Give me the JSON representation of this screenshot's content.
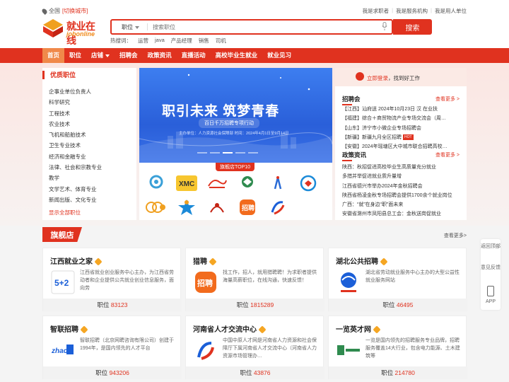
{
  "topbar": {
    "location": "全国",
    "switch_city": "[切换城市]",
    "links": [
      "我是求职者",
      "我是服务机构",
      "我是用人单位"
    ]
  },
  "logo": {
    "cn": "就业在线",
    "en": "jobonline"
  },
  "search": {
    "category": "职位",
    "placeholder": "搜索职位",
    "button": "搜索",
    "hot_label": "热搜词：",
    "hot_words": [
      "运营",
      "java",
      "产品经理",
      "销售",
      "司机"
    ]
  },
  "nav": {
    "items": [
      "首页",
      "职位",
      "店铺",
      "招聘会",
      "政策资讯",
      "直播活动",
      "高校毕业生就业",
      "就业见习"
    ],
    "active": "首页"
  },
  "categories": {
    "title": "优质职位",
    "items": [
      "企事业单位负责人",
      "科学研究",
      "工程技术",
      "农业技术",
      "飞机和船舶技术",
      "卫生专业技术",
      "经济和金融专业",
      "法律、社会和宗教专业",
      "教学",
      "文学艺术、体育专业",
      "新闻出版、文化专业"
    ],
    "all_link": "显示全部职位"
  },
  "banner": {
    "title": "职引未来  筑梦青春",
    "subtitle": "百日千万招聘专项行动",
    "info": "主办单位：人力资源社会保障部    时间：2024年4月1日至9月14日"
  },
  "top10": {
    "label": "旗舰店TOP10",
    "logos": [
      "icon-1",
      "icon-2",
      "icon-3",
      "icon-4",
      "icon-5",
      "icon-6",
      "icon-7",
      "icon-8",
      "icon-9",
      "icon-10"
    ]
  },
  "login": {
    "link": "立即登录",
    "text": "，找到好工作"
  },
  "fairs": {
    "title": "招聘会",
    "more": "查看更多 >",
    "items": [
      "【江西】汕府送 2024年10月23日 汉 在业扶",
      "【福建】综合＋商贸物流产业专场交流会（周…",
      "【山东】济宁市小微企业专场招聘会",
      "【新疆】新疆九月全区招聘",
      "【安徽】2024年瑶塘区大中城市联合招聘高校…"
    ]
  },
  "policy": {
    "title": "政策资讯",
    "more": "查看更多 >",
    "items": [
      "陕西：秋招促进高校毕业生高质量充分就业",
      "多措并举促进就业质升量增",
      "江西省德兴市举办2024年金秋招聘会",
      "陕西省杨凌金秋专场招聘会提供1700余个就业岗位",
      "广西：“就”在身边“职”面未来",
      "安徽省滁州市凤阳县总工会：金秋送岗促就业"
    ]
  },
  "shops": {
    "title": "旗舰店",
    "more": "查看更多>",
    "position_label": "职位",
    "cards": [
      {
        "name": "江西就业之家",
        "desc": "江西省就业创业服务中心主办，为江西省劳动者和企业提供公共就业创业信息服务，面向劳",
        "count": "83123",
        "logo": "jiangxi-logo-icon"
      },
      {
        "name": "猎聘",
        "desc": "找工作，招人，就用猎聘聘！为求职者提供海量高薪职位，在线沟通，快速反馈！",
        "count": "1815289",
        "logo": "liepin-logo-icon"
      },
      {
        "name": "湖北公共招聘",
        "desc": "湖北省劳动就业服务中心主办的大型公益性就业服务网站",
        "count": "46495",
        "logo": "hubei-logo-icon"
      },
      {
        "name": "智联招聘",
        "desc": "智联招聘（北京网聘咨询有限公司）创建于1994年，是国内领先的人才平台",
        "count": "943206",
        "logo": "zhaopin-logo-icon"
      },
      {
        "name": "河南省人才交流中心",
        "desc": "中国中原人才网是河南省人力资源和社会保障厅下属河南省人才交流中心（河南省人力资源市场管理办…",
        "count": "43876",
        "logo": "henan-logo-icon"
      },
      {
        "name": "一览英才网",
        "desc": "一览是国内领先的招聘服务专业品牌，招聘服务覆盖14大行业，包含电力能源、土木建筑等",
        "count": "214780",
        "logo": "yilan-logo-icon"
      }
    ]
  },
  "floatbar": {
    "top": "返回顶部",
    "feedback": "意见反馈",
    "app": "APP"
  },
  "colors": {
    "brand": "#e0321f",
    "accent": "#f0894a",
    "banner": "#2a5fd9"
  }
}
